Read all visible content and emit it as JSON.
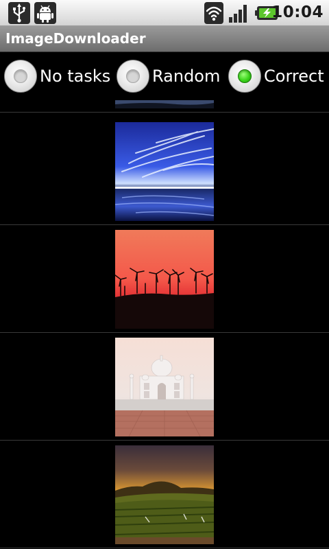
{
  "status_bar": {
    "time": "10:04",
    "icons": [
      "usb-icon",
      "android-debug-icon",
      "wifi-icon",
      "signal-icon",
      "battery-charging-icon"
    ]
  },
  "app": {
    "title": "ImageDownloader"
  },
  "mode_selector": {
    "options": [
      {
        "label": "No tasks",
        "checked": false
      },
      {
        "label": "Random",
        "checked": false
      },
      {
        "label": "Correct",
        "checked": true
      }
    ]
  },
  "images": [
    {
      "subject": "night-landscape"
    },
    {
      "subject": "blue-sky-clouds-reflection"
    },
    {
      "subject": "wind-turbines-red-sunset"
    },
    {
      "subject": "taj-mahal"
    },
    {
      "subject": "vineyard-sunset-hills"
    }
  ],
  "colors": {
    "radio_checked": "#3cd61c",
    "background": "#000000",
    "title_bar": "#7d7d7d",
    "status_bar": "#e6e6e6"
  }
}
